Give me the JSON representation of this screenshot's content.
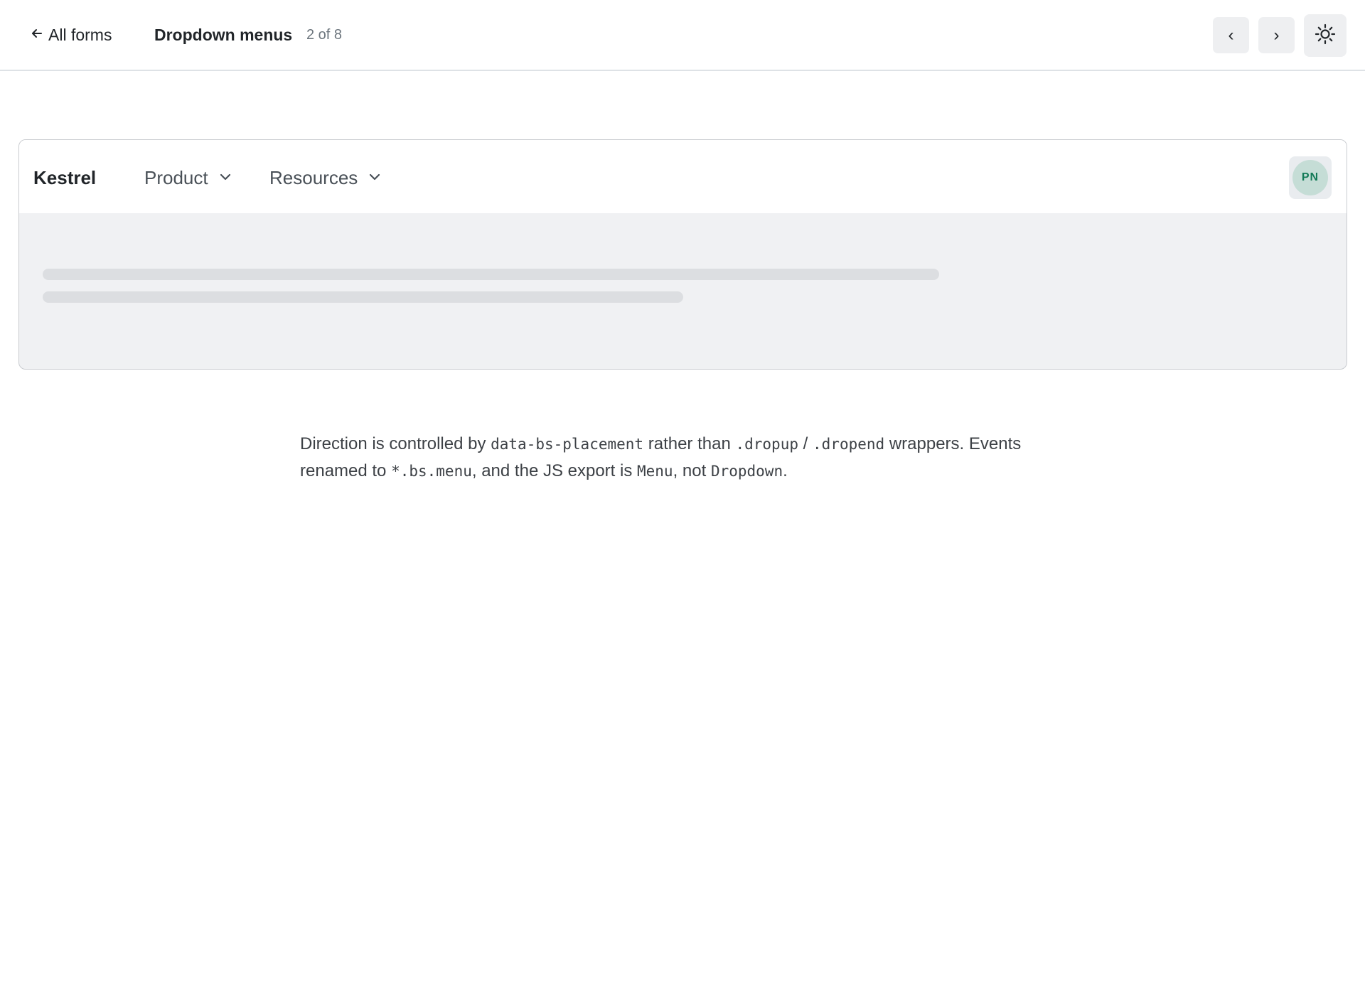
{
  "topbar": {
    "back_label": "All forms",
    "title": "Dropdown menus",
    "counter": "2 of 8",
    "prev_label": "‹",
    "next_label": "›",
    "theme_icon": "sun-icon"
  },
  "demo": {
    "brand": "Kestrel",
    "menus": [
      {
        "label": "Product",
        "icon": "chevron-down-icon"
      },
      {
        "label": "Resources",
        "icon": "chevron-down-icon"
      }
    ],
    "avatar_initials": "PN",
    "avatar_colors": {
      "bg": "#c5ddd6",
      "fg": "#137a57"
    }
  },
  "description": {
    "t1": "Direction is controlled by ",
    "c1": "data-bs-placement",
    "t2": " rather than ",
    "c2": ".dropup",
    "t3": " / ",
    "c3": ".dropend",
    "t4": " wrappers. Events renamed to ",
    "c4": "*.bs.menu",
    "t5": ", and the JS export is ",
    "c5": "Menu",
    "t6": ", not ",
    "c6": "Dropdown",
    "t7": "."
  }
}
